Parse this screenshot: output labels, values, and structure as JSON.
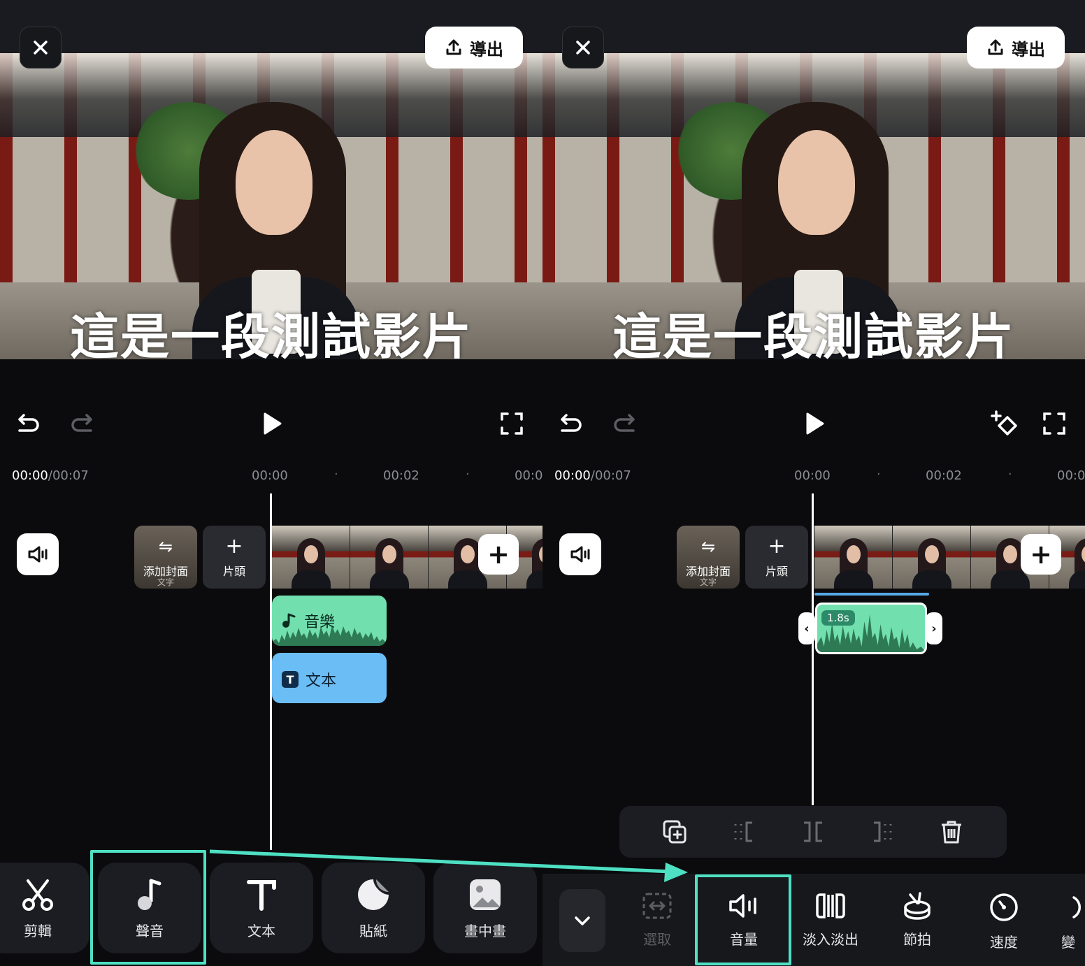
{
  "export_label": "導出",
  "caption": "這是一段測試影片",
  "timeline": {
    "current": "00:00",
    "total": "/00:07",
    "marks": [
      "00:00",
      "00:02",
      "00:0"
    ]
  },
  "cover": {
    "label": "添加封面",
    "sub": "文字"
  },
  "head": {
    "label": "片頭"
  },
  "left_tracks": {
    "music": "音樂",
    "text": "文本"
  },
  "left_tools": [
    {
      "label": "剪輯",
      "icon": "scissors-icon"
    },
    {
      "label": "聲音",
      "icon": "music-note-icon"
    },
    {
      "label": "文本",
      "icon": "text-icon"
    },
    {
      "label": "貼紙",
      "icon": "sticker-icon"
    },
    {
      "label": "畫中畫",
      "icon": "picture-in-picture-icon"
    }
  ],
  "right_clip": {
    "duration": "1.8s"
  },
  "right_tools": [
    {
      "label": "選取",
      "icon": "select-icon",
      "disabled": true
    },
    {
      "label": "音量",
      "icon": "volume-icon"
    },
    {
      "label": "淡入淡出",
      "icon": "fade-icon"
    },
    {
      "label": "節拍",
      "icon": "beat-icon"
    },
    {
      "label": "速度",
      "icon": "speed-icon"
    },
    {
      "label": "變",
      "icon": "voice-change-icon"
    }
  ],
  "highlight_color": "#4ee0c3",
  "music_color": "#72e0ae",
  "text_color": "#6bbdf5"
}
